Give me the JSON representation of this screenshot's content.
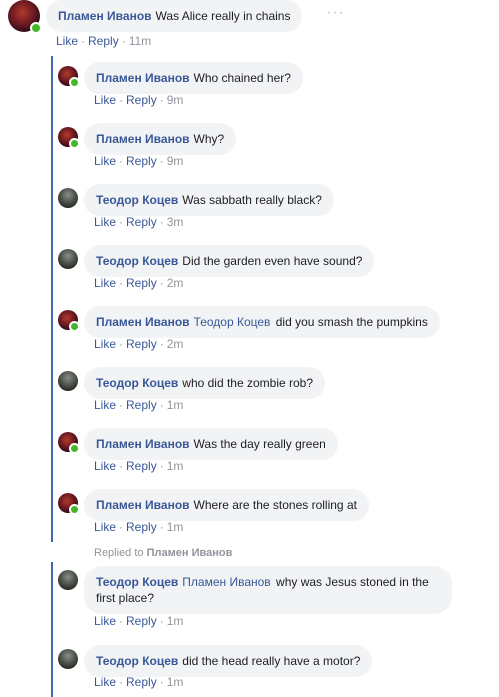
{
  "top_comment": {
    "author": "Пламен Иванов",
    "text": "Was Alice really in chains",
    "like": "Like",
    "reply": "Reply",
    "time": "11m",
    "avatar": "plamen",
    "online": true
  },
  "more_icon": "more-horizontal-icon",
  "replied_to_label": "Replied to",
  "replied_to_name": "Пламен Иванов",
  "replies": [
    {
      "author": "Пламен Иванов",
      "mention": "",
      "text": "Who chained her?",
      "like": "Like",
      "reply": "Reply",
      "time": "9m",
      "avatar": "plamen",
      "online": true
    },
    {
      "author": "Пламен Иванов",
      "mention": "",
      "text": "Why?",
      "like": "Like",
      "reply": "Reply",
      "time": "9m",
      "avatar": "plamen",
      "online": true
    },
    {
      "author": "Теодор Коцев",
      "mention": "",
      "text": "Was sabbath really black?",
      "like": "Like",
      "reply": "Reply",
      "time": "3m",
      "avatar": "teodor",
      "online": false
    },
    {
      "author": "Теодор Коцев",
      "mention": "",
      "text": "Did the garden even have sound?",
      "like": "Like",
      "reply": "Reply",
      "time": "2m",
      "avatar": "teodor",
      "online": false
    },
    {
      "author": "Пламен Иванов",
      "mention": "Теодор Коцев",
      "text": "did you smash the pumpkins",
      "like": "Like",
      "reply": "Reply",
      "time": "2m",
      "avatar": "plamen",
      "online": true
    },
    {
      "author": "Теодор Коцев",
      "mention": "",
      "text": "who did the zombie rob?",
      "like": "Like",
      "reply": "Reply",
      "time": "1m",
      "avatar": "teodor",
      "online": false
    },
    {
      "author": "Пламен Иванов",
      "mention": "",
      "text": "Was the day really green",
      "like": "Like",
      "reply": "Reply",
      "time": "1m",
      "avatar": "plamen",
      "online": true
    },
    {
      "author": "Пламен Иванов",
      "mention": "",
      "text": "Where are the stones rolling at",
      "like": "Like",
      "reply": "Reply",
      "time": "1m",
      "avatar": "plamen",
      "online": true
    },
    {
      "author": "Теодор Коцев",
      "mention": "Пламен Иванов",
      "text": "why was Jesus stoned in the first place?",
      "like": "Like",
      "reply": "Reply",
      "time": "1m",
      "avatar": "teodor",
      "online": false
    },
    {
      "author": "Теодор Коцев",
      "mention": "",
      "text": "did the head really have a motor?",
      "like": "Like",
      "reply": "Reply",
      "time": "1m",
      "avatar": "teodor",
      "online": false
    }
  ]
}
